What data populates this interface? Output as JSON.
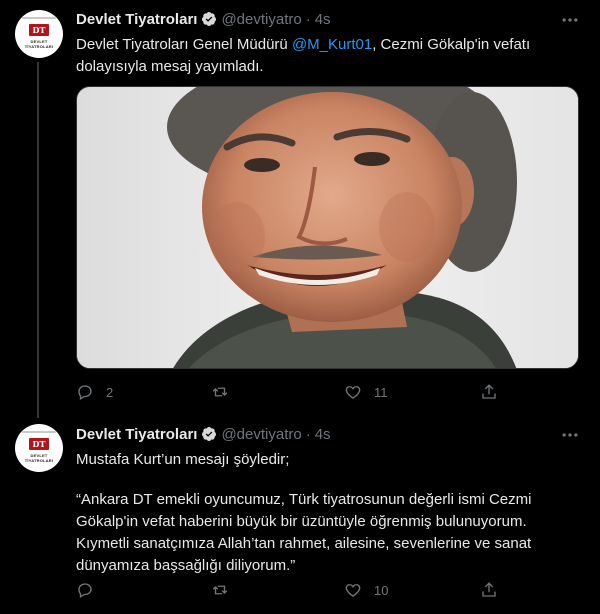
{
  "colors": {
    "background": "#000000",
    "link": "#1d9bf0",
    "muted": "#71767b",
    "verified": "#d9d9d9"
  },
  "tweets": [
    {
      "author": "Devlet Tiyatroları",
      "handle": "@devtiyatro",
      "separator": "·",
      "time": "4s",
      "avatar": {
        "mark": "DT",
        "caption_line1": "DEVLET",
        "caption_line2": "TİYATROLARI"
      },
      "text_before": "Devlet Tiyatroları Genel Müdürü ",
      "mention": "@M_Kurt01",
      "text_after": ", Cezmi Gökalp'in vefatı dolayısıyla mesaj yayımladı.",
      "has_image": true,
      "image_alt": "photo-of-smiling-man",
      "replies": "2",
      "retweets": "",
      "likes": "11"
    },
    {
      "author": "Devlet Tiyatroları",
      "handle": "@devtiyatro",
      "separator": "·",
      "time": "4s",
      "avatar": {
        "mark": "DT",
        "caption_line1": "DEVLET",
        "caption_line2": "TİYATROLARI"
      },
      "paragraph1": "Mustafa Kurt’un mesajı şöyledir;",
      "paragraph2": "“Ankara DT emekli oyuncumuz, Türk tiyatrosunun değerli ismi Cezmi Gökalp'in vefat haberini büyük bir üzüntüyle öğrenmiş bulunuyorum. Kıymetli sanatçımıza Allah’tan rahmet, ailesine, sevenlerine ve sanat dünyamıza başsağlığı diliyorum.”",
      "replies": "",
      "retweets": "",
      "likes": "10"
    }
  ]
}
